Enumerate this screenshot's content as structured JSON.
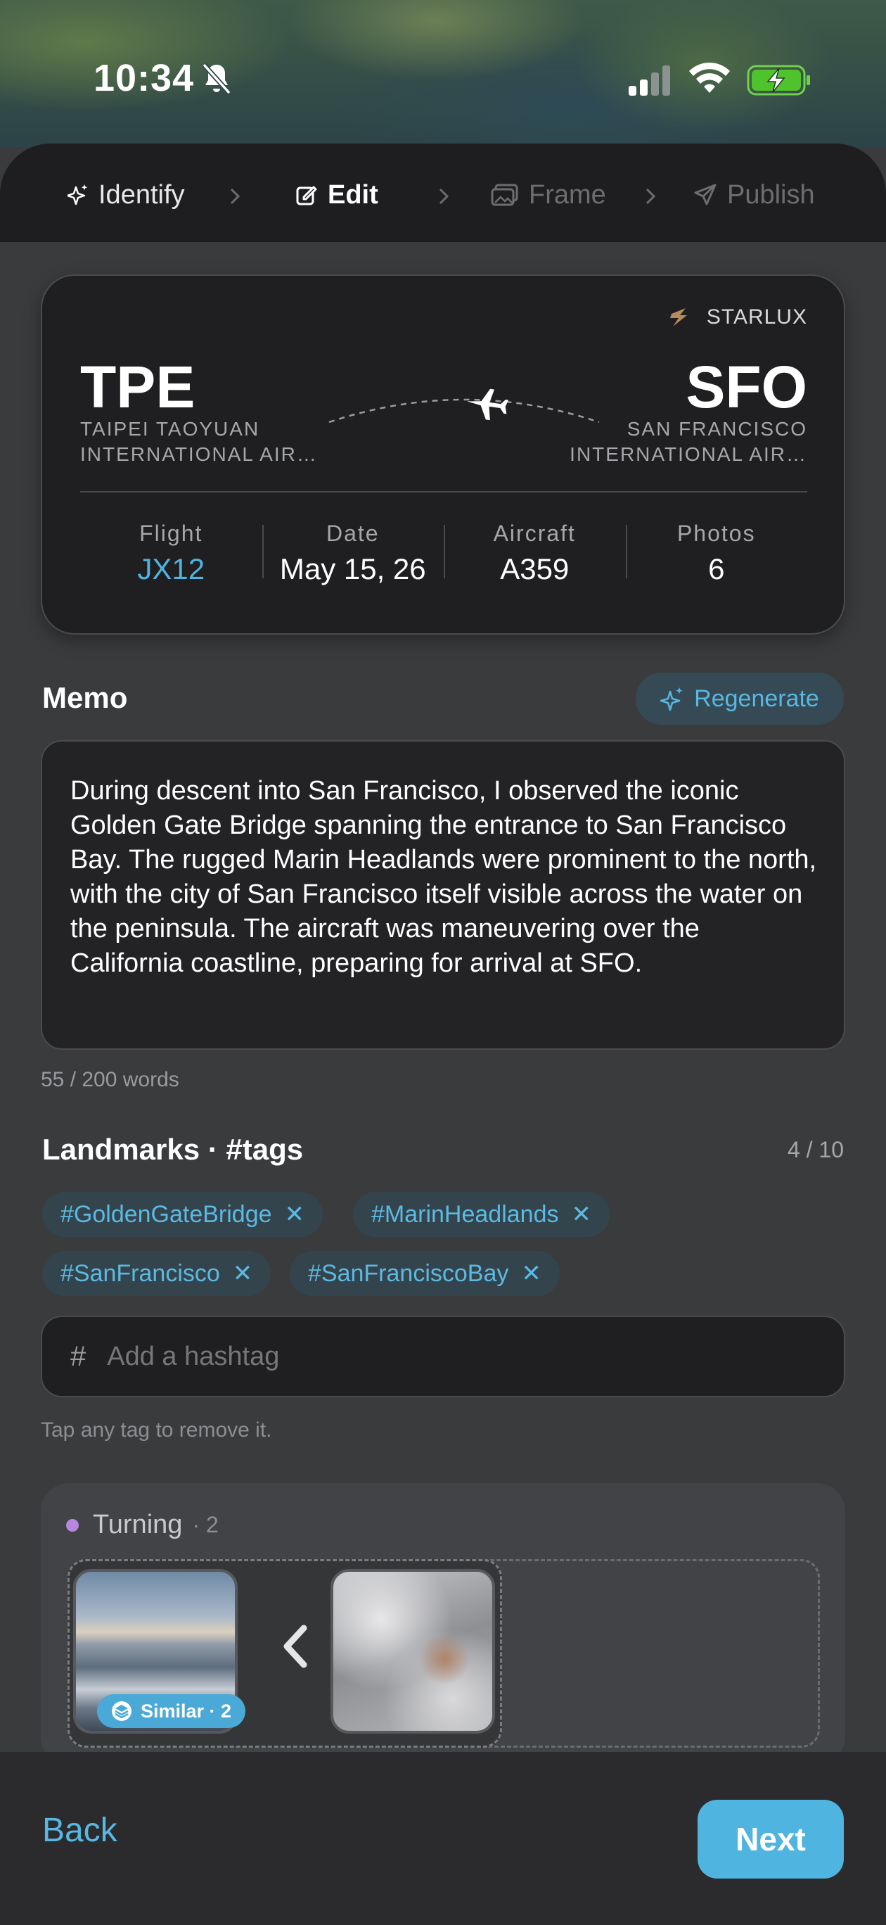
{
  "status_bar": {
    "time": "10:34",
    "icons": [
      "bell-slash-icon",
      "cellular-signal-icon",
      "wifi-icon",
      "battery-charging-icon"
    ]
  },
  "stepper": {
    "steps": [
      {
        "label": "Identify",
        "state": "done",
        "icon": "sparkle-icon"
      },
      {
        "label": "Edit",
        "state": "active",
        "icon": "edit-icon"
      },
      {
        "label": "Frame",
        "state": "future",
        "icon": "photos-icon"
      },
      {
        "label": "Publish",
        "state": "future",
        "icon": "send-icon"
      }
    ]
  },
  "flight": {
    "airline": "STARLUX",
    "from_code": "TPE",
    "from_name": "TAIPEI TAOYUAN INTERNATIONAL AIR…",
    "to_code": "SFO",
    "to_name": "SAN FRANCISCO INTERNATIONAL AIR…",
    "stats": [
      {
        "label": "Flight",
        "value": "JX12"
      },
      {
        "label": "Date",
        "value": "May 15, 26"
      },
      {
        "label": "Aircraft",
        "value": "A359"
      },
      {
        "label": "Photos",
        "value": "6"
      }
    ]
  },
  "memo": {
    "title": "Memo",
    "regenerate_label": "Regenerate",
    "text": "During descent into San Francisco, I observed the iconic Golden Gate Bridge spanning the entrance to San Francisco Bay. The rugged Marin Headlands were prominent to the north, with the city of San Francisco itself visible across the water on the peninsula. The aircraft was maneuvering over the California coastline, preparing for arrival at SFO.",
    "word_count": "55 / 200 words"
  },
  "landmarks": {
    "title": "Landmarks · #tags",
    "count": "4 / 10",
    "tags": [
      "#GoldenGateBridge",
      "#MarinHeadlands",
      "#SanFrancisco",
      "#SanFranciscoBay"
    ],
    "remove_glyph": "✕",
    "input_prefix": "#",
    "input_placeholder": "Add a hashtag",
    "input_value": "",
    "hint": "Tap any tag to remove it."
  },
  "group": {
    "name": "Turning",
    "count": "· 2",
    "dot_color": "#b787e0",
    "similar_label": "Similar · 2"
  },
  "footer": {
    "back_label": "Back",
    "next_label": "Next"
  },
  "colors": {
    "accent": "#4fb4e0",
    "tag_bg": "#34444d",
    "background": "#3a3b3d"
  }
}
